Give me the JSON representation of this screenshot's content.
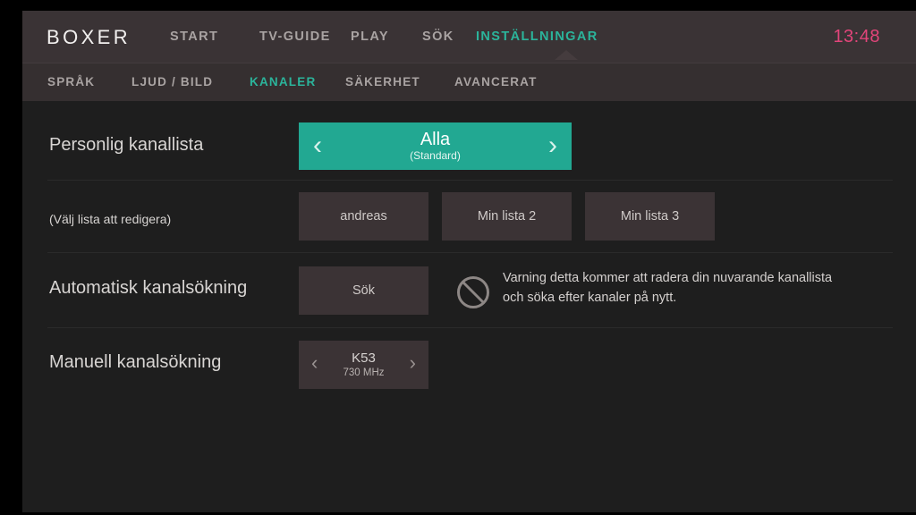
{
  "header": {
    "brand": "BOXER",
    "clock": "13:48",
    "nav": [
      {
        "label": "START",
        "active": false
      },
      {
        "label": "TV-GUIDE",
        "active": false
      },
      {
        "label": "PLAY",
        "active": false
      },
      {
        "label": "SÖK",
        "active": false
      },
      {
        "label": "INSTÄLLNINGAR",
        "active": true
      }
    ]
  },
  "subnav": {
    "items": [
      {
        "label": "SPRÅK",
        "active": false
      },
      {
        "label": "LJUD / BILD",
        "active": false
      },
      {
        "label": "KANALER",
        "active": true
      },
      {
        "label": "SÄKERHET",
        "active": false
      },
      {
        "label": "AVANCERAT",
        "active": false
      }
    ]
  },
  "settings": {
    "personal_list": {
      "label": "Personlig kanallista",
      "selector": {
        "value": "Alla",
        "sub": "(Standard)",
        "prev_icon": "chevron-left-icon",
        "next_icon": "chevron-right-icon"
      }
    },
    "edit_list": {
      "label": "(Välj lista att redigera)",
      "buttons": [
        {
          "label": "andreas"
        },
        {
          "label": "Min lista 2"
        },
        {
          "label": "Min lista 3"
        }
      ]
    },
    "auto_scan": {
      "label": "Automatisk kanalsökning",
      "button": "Sök",
      "warning_icon": "prohibition-icon",
      "warning": "Varning detta kommer att radera din nuvarande kanallista och söka efter kanaler på nytt."
    },
    "manual_scan": {
      "label": "Manuell kanalsökning",
      "stepper": {
        "value": "K53",
        "sub": "730 MHz",
        "prev_icon": "chevron-left-icon",
        "next_icon": "chevron-right-icon"
      }
    }
  },
  "colors": {
    "accent_teal": "#22a892",
    "clock_pink": "#e2457a",
    "header_bg": "#3a3335",
    "content_bg": "#1e1e1e",
    "button_bg": "#3b3335"
  }
}
